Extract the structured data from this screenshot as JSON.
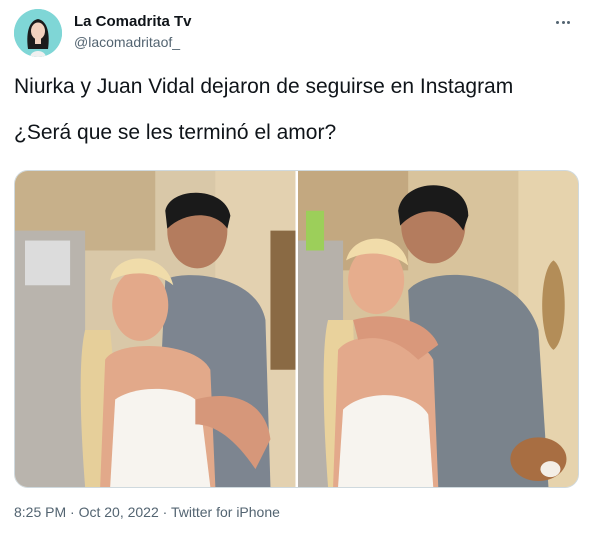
{
  "author": {
    "display_name": "La Comadrita Tv",
    "handle": "@lacomadritaof_",
    "avatar_icon": "avatar-illustration"
  },
  "tweet": {
    "line1": "Niurka y Juan Vidal dejaron de seguirse en Instagram",
    "line2": "¿Será que se les terminó el amor?"
  },
  "media": {
    "photos": [
      {
        "name": "photo-1",
        "description_icon": "couple-photo"
      },
      {
        "name": "photo-2",
        "description_icon": "couple-kiss-photo"
      }
    ]
  },
  "meta": {
    "time": "8:25 PM",
    "separator": "·",
    "date": "Oct 20, 2022",
    "client": "Twitter for iPhone"
  },
  "colors": {
    "text_primary": "#0f1419",
    "text_secondary": "#536471",
    "border": "#cfd9de",
    "avatar_bg": "#7fd6d6"
  }
}
